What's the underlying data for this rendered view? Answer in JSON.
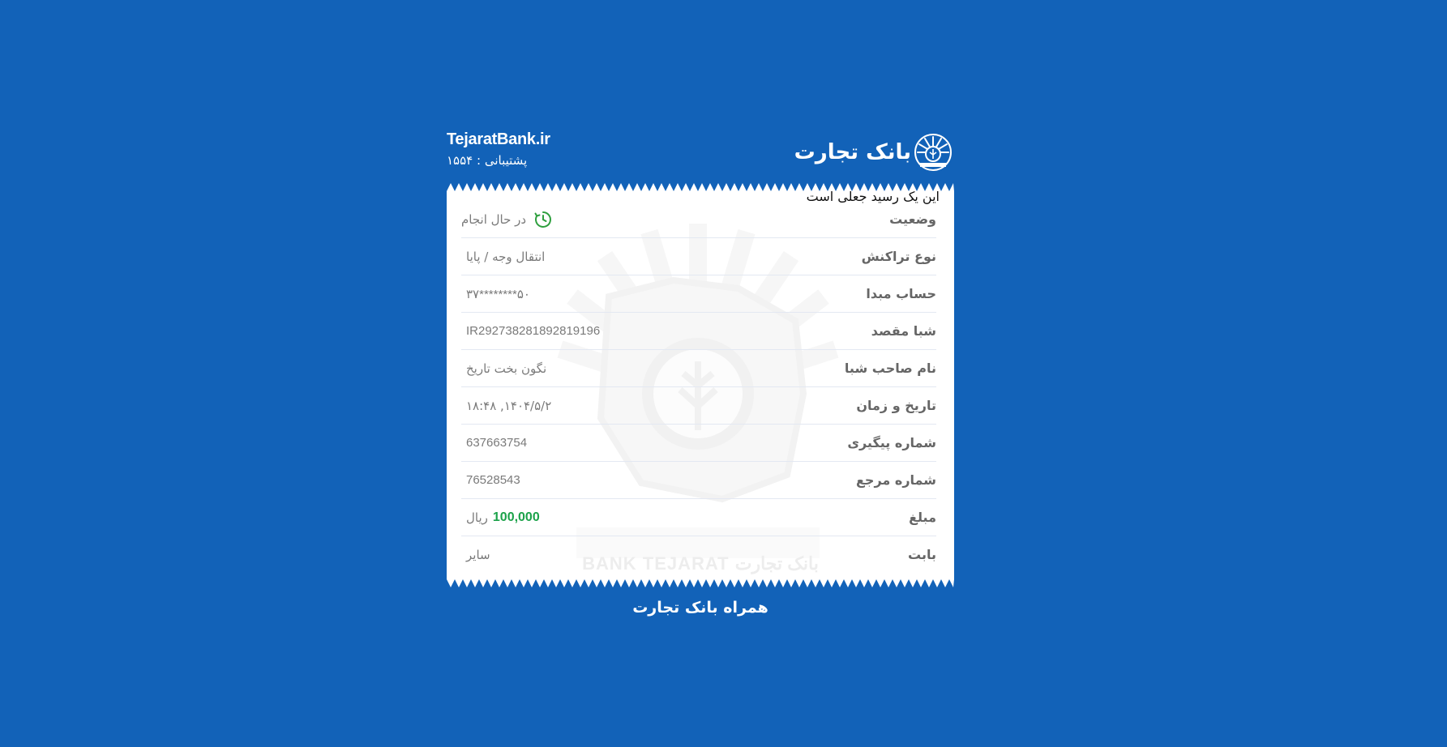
{
  "header": {
    "site": "TejaratBank.ir",
    "support": "پشتیبانی : ۱۵۵۴",
    "logo_text": "بانک تجارت"
  },
  "receipt": {
    "notice": "این یک رسید جعلی است",
    "watermark_text": "BANK TEJARAT  بانک تجارت",
    "status": {
      "label": "وضعیت",
      "value": "در حال انجام",
      "icon": "pending-clock-icon",
      "icon_color": "#2e9f3e"
    },
    "rows": [
      {
        "label": "نوع تراکنش",
        "value": "انتقال وجه / پایا"
      },
      {
        "label": "حساب مبدا",
        "value": "۳۷********۵۰"
      },
      {
        "label": "شبا مقصد",
        "value": "IR292738281892819196"
      },
      {
        "label": "نام صاحب شبا",
        "value": "نگون بخت تاریخ"
      },
      {
        "label": "تاریخ و زمان",
        "value": "۱۴۰۴/۵/۲, ۱۸:۴۸"
      },
      {
        "label": "شماره پیگیری",
        "value": "637663754"
      },
      {
        "label": "شماره مرجع",
        "value": "76528543"
      }
    ],
    "amount": {
      "label": "مبلغ",
      "number": "100,000",
      "currency": "ریال",
      "color": "#1ca24a"
    },
    "purpose": {
      "label": "بابت",
      "value": "سایر"
    }
  },
  "footer": {
    "text": "همراه بانک تجارت"
  },
  "colors": {
    "background": "#1262b8",
    "receipt": "#ffffff"
  }
}
